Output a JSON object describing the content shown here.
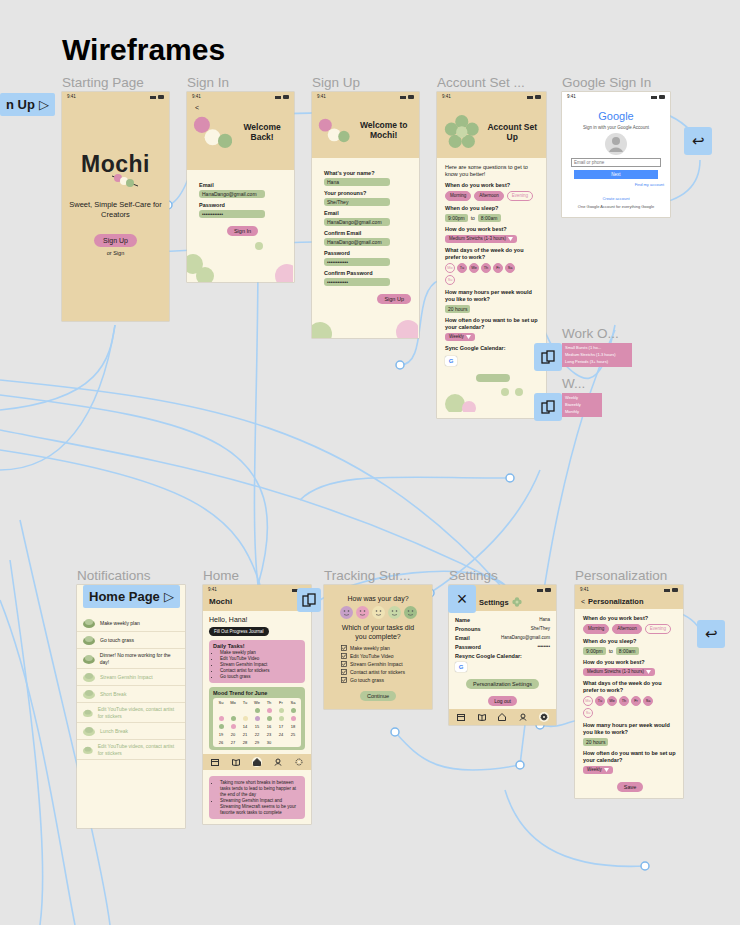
{
  "canvas": {
    "title": "Wireframes"
  },
  "status_time": "9:41",
  "flow_starts": [
    {
      "label": "n Up",
      "icon": "▷"
    },
    {
      "label": "Home Page",
      "icon": "▷"
    }
  ],
  "back_buttons": [
    {
      "icon": "↩"
    },
    {
      "icon": "↩"
    }
  ],
  "starting": {
    "label": "Starting Page",
    "logo": "Mochi",
    "tagline": "Sweet, Simple Self-Care for Creators",
    "button": "Sign Up",
    "link": "or Sign"
  },
  "sign_in": {
    "label": "Sign In",
    "back": "<",
    "title": "Welcome Back!",
    "fields": [
      {
        "label": "Email",
        "value": "HanaDango@gmail.com"
      },
      {
        "label": "Password",
        "value": "••••••••••••"
      }
    ],
    "button": "Sign In"
  },
  "sign_up": {
    "label": "Sign Up",
    "title": "Welcome to Mochi!",
    "fields": [
      {
        "label": "What's your name?",
        "value": "Hana"
      },
      {
        "label": "Your pronouns?",
        "value": "She/They"
      },
      {
        "label": "Email",
        "value": "HanaDango@gmail.com"
      },
      {
        "label": "Confirm Email",
        "value": "HanaDango@gmail.com"
      },
      {
        "label": "Password",
        "value": "••••••••••••"
      },
      {
        "label": "Confirm Password",
        "value": "••••••••••••"
      }
    ],
    "button": "Sign Up"
  },
  "account": {
    "label": "Account Set ...",
    "title": "Account Set Up",
    "intro": "Here are some questions to get to know you better!",
    "questions": [
      {
        "kind": "chips",
        "question": "When do you work best?",
        "options": [
          {
            "label": "Morning",
            "selected": true
          },
          {
            "label": "Afternoon",
            "selected": true
          },
          {
            "label": "Evening",
            "selected": false
          }
        ]
      },
      {
        "kind": "range",
        "question": "When do you sleep?",
        "from": "9:00pm",
        "sep": "to",
        "to": "8:00am"
      },
      {
        "kind": "select",
        "question": "How do you work best?",
        "value": "Medium Stretchs (1-3 hours)"
      },
      {
        "kind": "days",
        "question": "What days of the week do you prefer to work?",
        "options": [
          {
            "label": "Mo",
            "selected": false
          },
          {
            "label": "Tu",
            "selected": true
          },
          {
            "label": "We",
            "selected": true
          },
          {
            "label": "Th",
            "selected": true
          },
          {
            "label": "Fr",
            "selected": true
          },
          {
            "label": "Sa",
            "selected": true
          },
          {
            "label": "Su",
            "selected": false
          }
        ]
      },
      {
        "kind": "value",
        "question": "How many hours per week would you like to work?",
        "value": "20 hours"
      },
      {
        "kind": "select",
        "question": "How often do you want to be set up your calendar?",
        "value": "Weekly"
      }
    ],
    "sync": "Sync Google Calendar:",
    "google": "G"
  },
  "personalization": {
    "label": "Personalization",
    "back": "<",
    "title": "Personalization",
    "questions": [
      {
        "kind": "chips",
        "question": "When do you work best?",
        "options": [
          {
            "label": "Morning",
            "selected": true
          },
          {
            "label": "Afternoon",
            "selected": true
          },
          {
            "label": "Evening",
            "selected": false
          }
        ]
      },
      {
        "kind": "range",
        "question": "When do you sleep?",
        "from": "9:00pm",
        "sep": "to",
        "to": "8:00am"
      },
      {
        "kind": "select",
        "question": "How do you work best?",
        "value": "Medium Stretchs (1-3 hours)"
      },
      {
        "kind": "days",
        "question": "What days of the week do you prefer to work?",
        "options": [
          {
            "label": "Mo",
            "selected": false
          },
          {
            "label": "Tu",
            "selected": true
          },
          {
            "label": "We",
            "selected": true
          },
          {
            "label": "Th",
            "selected": true
          },
          {
            "label": "Fr",
            "selected": true
          },
          {
            "label": "Sa",
            "selected": true
          },
          {
            "label": "Su",
            "selected": false
          }
        ]
      },
      {
        "kind": "value",
        "question": "How many hours per week would you like to work?",
        "value": "20 hours"
      },
      {
        "kind": "select",
        "question": "How often do you want to be set up your calendar?",
        "value": "Weekly"
      }
    ],
    "button": "Save"
  },
  "google": {
    "label": "Google Sign In",
    "logo": "Google",
    "subtitle": "Sign in with your Google Account",
    "placeholder": "Email or phone",
    "next": "Next",
    "find": "Find my account",
    "create": "Create account",
    "footer": "One Google Account for everything Google"
  },
  "popups": [
    {
      "label": "Work O...",
      "items": [
        "Small Bursts (1 ho...",
        "Medium Stretchs (1-3 hours)",
        "Long Periods (3+ hours)"
      ]
    },
    {
      "label": "W...",
      "items": [
        "Weekly",
        "Biweekly",
        "Monthly"
      ]
    }
  ],
  "notifications": {
    "label": "Notifications",
    "items": [
      {
        "text": "Make weekly plan",
        "faded": false
      },
      {
        "text": "Go touch grass",
        "faded": false
      },
      {
        "text": "Dinner! No more working for the day!",
        "faded": false
      },
      {
        "text": "Stream Genshin Impact",
        "faded": true
      },
      {
        "text": "Short Break",
        "faded": true
      },
      {
        "text": "Edit YouTube videos, contact artist for stickers",
        "faded": true
      },
      {
        "text": "Lunch Break",
        "faded": true
      },
      {
        "text": "Edit YouTube videos, contact artist for stickers",
        "faded": true
      }
    ]
  },
  "home": {
    "label": "Home",
    "logo": "Mochi",
    "greeting": "Hello, Hana!",
    "journal": "Fill Out Progress Journal",
    "tasks_title": "Daily Tasks!",
    "tasks": [
      "Make weekly plan",
      "Edit YouTube Video",
      "Stream Genshin Impact",
      "Contact artist for stickers",
      "Go touch grass"
    ],
    "mood_title": "Mood Trend for June",
    "weekdays": [
      "Su",
      "Mo",
      "Tu",
      "We",
      "Th",
      "Fr",
      "Sa"
    ],
    "days": [
      {
        "kind": "dot",
        "color": "#9fbd88"
      },
      {
        "kind": "dot",
        "color": "#e7a2be"
      },
      {
        "kind": "dot",
        "color": "#c8d8a8"
      },
      {
        "kind": "dot",
        "color": "#9fbd88"
      },
      {
        "kind": "dot",
        "color": "#e7a2be"
      },
      {
        "kind": "dot",
        "color": "#9fbd88"
      },
      {
        "kind": "dot",
        "color": "#efe3b5"
      },
      {
        "kind": "dot",
        "color": "#c7a0c8"
      },
      {
        "kind": "dot",
        "color": "#9fbd88"
      },
      {
        "kind": "dot",
        "color": "#c8d8a8"
      },
      {
        "kind": "dot",
        "color": "#e7a2be"
      },
      {
        "kind": "dot",
        "color": "#9fbd88"
      },
      {
        "kind": "dot",
        "color": "#e7a2be"
      },
      {
        "kind": "num",
        "label": "14"
      },
      {
        "kind": "num",
        "label": "15"
      },
      {
        "kind": "num",
        "label": "16"
      },
      {
        "kind": "num",
        "label": "17"
      },
      {
        "kind": "num",
        "label": "18"
      },
      {
        "kind": "num",
        "label": "19"
      },
      {
        "kind": "num",
        "label": "20"
      },
      {
        "kind": "num",
        "label": "21"
      },
      {
        "kind": "num",
        "label": "22"
      },
      {
        "kind": "num",
        "label": "23"
      },
      {
        "kind": "num",
        "label": "24"
      },
      {
        "kind": "num",
        "label": "25"
      },
      {
        "kind": "num",
        "label": "26"
      },
      {
        "kind": "num",
        "label": "27"
      },
      {
        "kind": "num",
        "label": "28"
      },
      {
        "kind": "num",
        "label": "29"
      },
      {
        "kind": "num",
        "label": "30"
      }
    ],
    "insights": [
      "Taking more short breaks in between tasks tends to lead to being happier at the end of the day",
      "Streaming Genshin Impact and Streaming Minecraft seems to be your favorite work tasks to complete"
    ],
    "nav": [
      {
        "selected": false
      },
      {
        "selected": false
      },
      {
        "selected": true
      },
      {
        "selected": false
      },
      {
        "selected": false
      }
    ]
  },
  "tracking": {
    "label": "Tracking Sur...",
    "question": "How was your day?",
    "faces": [
      {
        "color": "#c7a0c8"
      },
      {
        "color": "#e7a2be"
      },
      {
        "color": "#efe3b5"
      },
      {
        "color": "#c8d8a8"
      },
      {
        "color": "#9fbd88"
      }
    ],
    "tasks_question": "Which of your tasks did you complete?",
    "tasks": [
      {
        "text": "Make weekly plan",
        "checked": true
      },
      {
        "text": "Edit YouTube Video",
        "checked": true
      },
      {
        "text": "Stream Genshin Impact",
        "checked": true
      },
      {
        "text": "Contact artist for stickers",
        "checked": true
      },
      {
        "text": "Go touch grass",
        "checked": true
      }
    ],
    "button": "Continue"
  },
  "settings": {
    "label": "Settings",
    "title": "Settings",
    "close": "×",
    "rows": [
      {
        "label": "Name",
        "value": "Hana"
      },
      {
        "label": "Pronouns",
        "value": "She/They"
      },
      {
        "label": "Email",
        "value": "HanaDango@gmail.com"
      },
      {
        "label": "Password",
        "value": "••••••••"
      }
    ],
    "resync": "Resync Google Calendar:",
    "google": "G",
    "personalization": "Personalization Settings",
    "logout": "Log out",
    "nav": [
      {
        "selected": false
      },
      {
        "selected": false
      },
      {
        "selected": false
      },
      {
        "selected": false
      },
      {
        "selected": true
      }
    ]
  }
}
